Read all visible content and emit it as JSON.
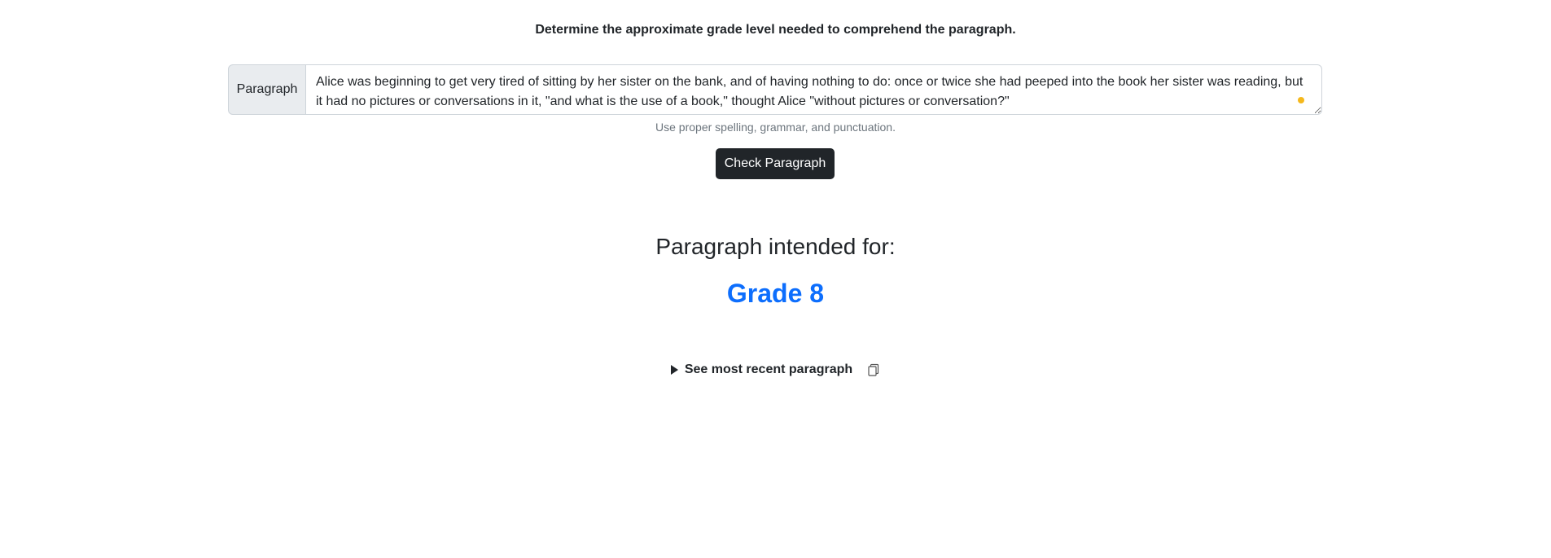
{
  "instruction": "Determine the approximate grade level needed to comprehend the paragraph.",
  "form": {
    "label": "Paragraph",
    "value": "Alice was beginning to get very tired of sitting by her sister on the bank, and of having nothing to do: once or twice she had peeped into the book her sister was reading, but it had no pictures or conversations in it, \"and what is the use of a book,\" thought Alice \"without pictures or conversation?\"",
    "helper": "Use proper spelling, grammar, and punctuation.",
    "button_label": "Check Paragraph"
  },
  "result": {
    "heading": "Paragraph intended for:",
    "grade": "Grade 8"
  },
  "recent": {
    "toggle_label": "See most recent paragraph",
    "toggle_icon": "triangle-right-icon",
    "copy_icon": "copy-icon"
  },
  "colors": {
    "accent": "#0d6efd",
    "button_bg": "#212529",
    "status_dot": "#f5b81c"
  }
}
